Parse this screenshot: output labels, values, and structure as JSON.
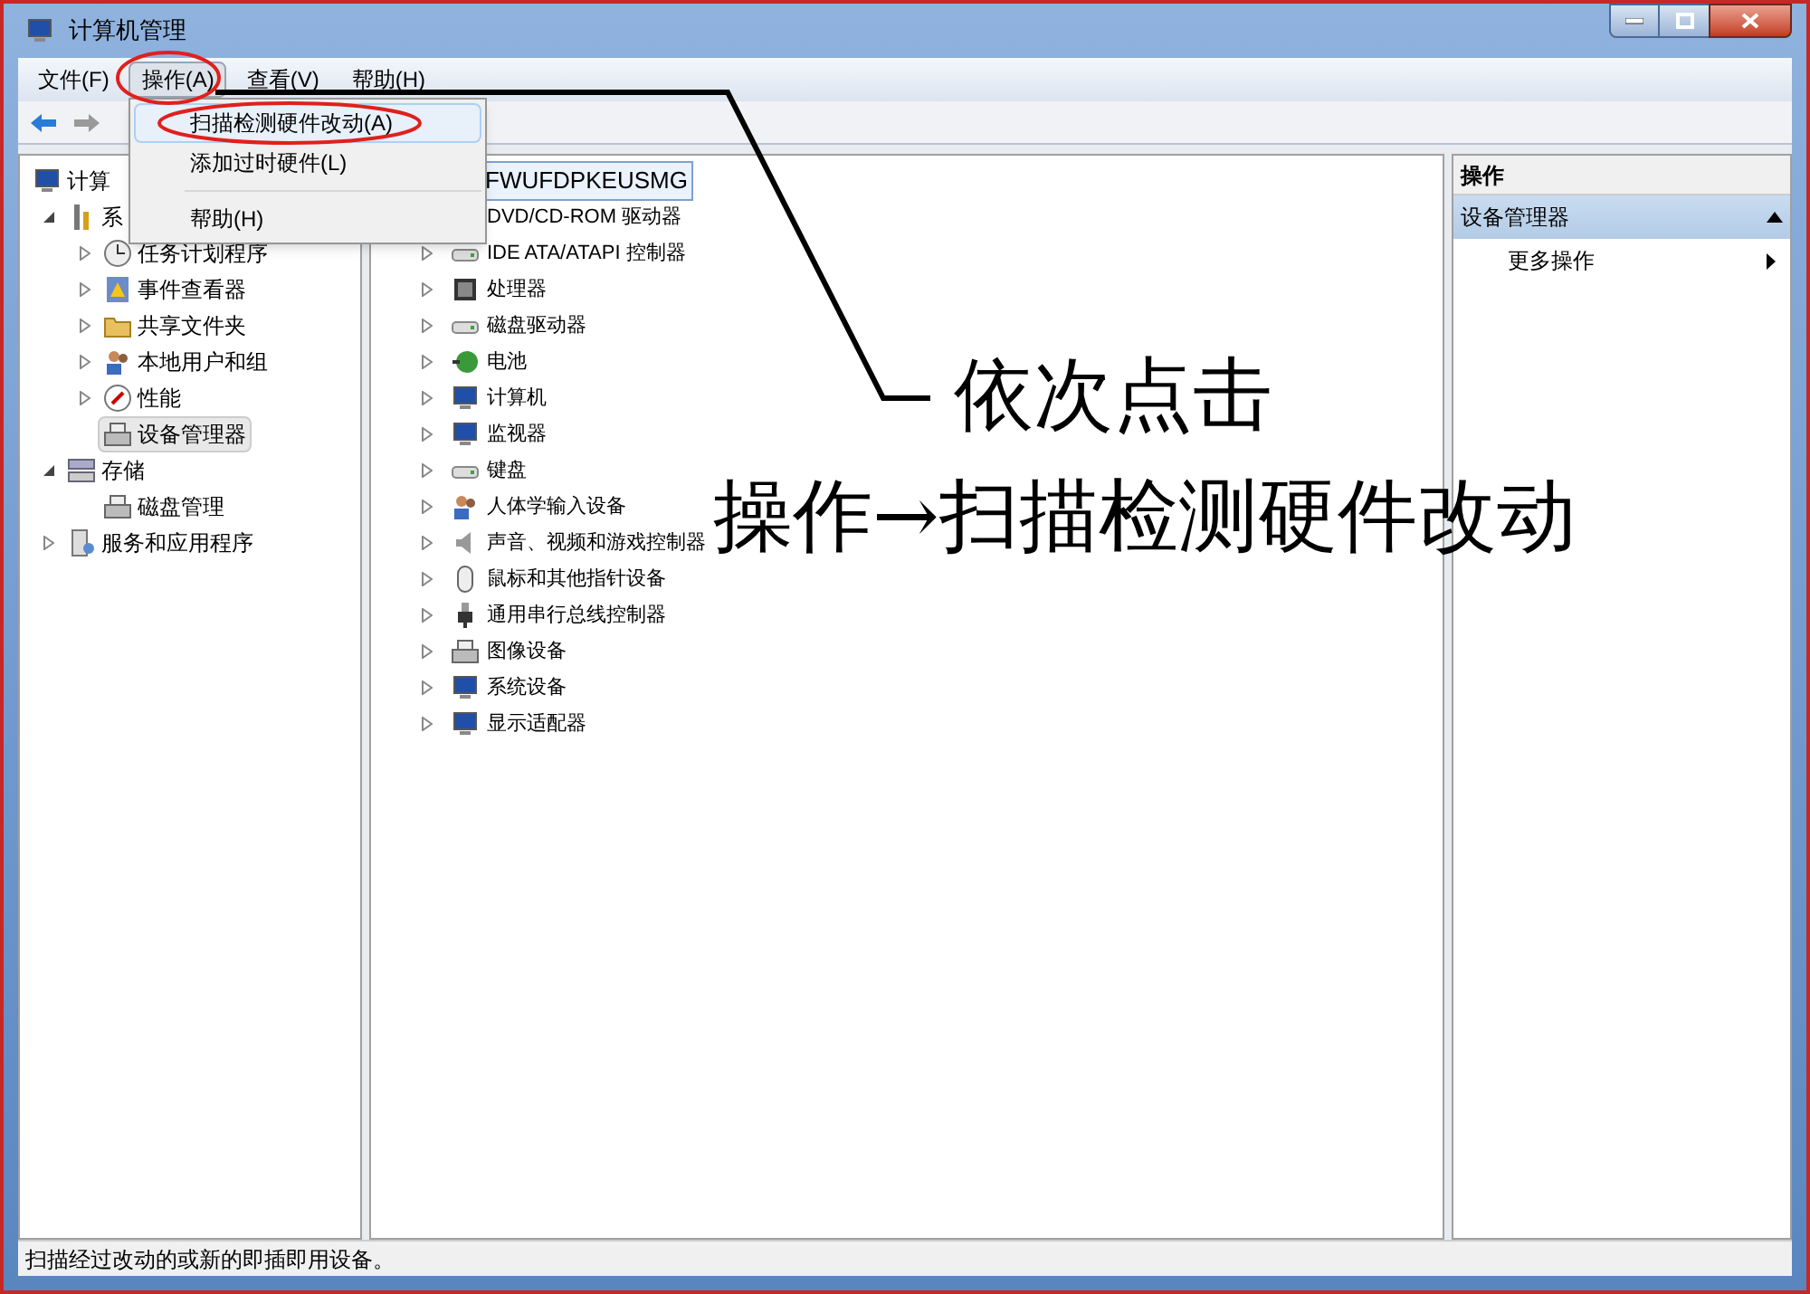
{
  "window": {
    "title": "计算机管理"
  },
  "menu_bar": [
    {
      "label": "文件(F)",
      "selected": false
    },
    {
      "label": "操作(A)",
      "selected": true
    },
    {
      "label": "查看(V)",
      "selected": false
    },
    {
      "label": "帮助(H)",
      "selected": false
    }
  ],
  "dropdown": [
    {
      "kind": "item",
      "label": "扫描检测硬件改动(A)",
      "selected": true
    },
    {
      "kind": "item",
      "label": "添加过时硬件(L)",
      "selected": false
    },
    {
      "kind": "separator"
    },
    {
      "kind": "item",
      "label": "帮助(H)",
      "selected": false
    }
  ],
  "nav_tree": [
    {
      "label": "计算",
      "kind": "computer",
      "selected": false,
      "children": [
        {
          "label": "系",
          "kind": "tools",
          "expanded": true,
          "selected": false,
          "children": [
            {
              "label": "任务计划程序",
              "kind": "clock",
              "expanded": false,
              "selected": false
            },
            {
              "label": "事件查看器",
              "kind": "event",
              "expanded": false,
              "selected": false
            },
            {
              "label": "共享文件夹",
              "kind": "folder",
              "expanded": false,
              "selected": false
            },
            {
              "label": "本地用户和组",
              "kind": "users",
              "expanded": false,
              "selected": false
            },
            {
              "label": "性能",
              "kind": "gauge",
              "expanded": false,
              "selected": false
            },
            {
              "label": "设备管理器",
              "kind": "device",
              "selected": true
            }
          ]
        },
        {
          "label": "存储",
          "kind": "storage",
          "expanded": true,
          "selected": false,
          "children": [
            {
              "label": "磁盘管理",
              "kind": "device",
              "selected": false
            }
          ]
        },
        {
          "label": "服务和应用程序",
          "kind": "services",
          "expanded": false,
          "selected": false
        }
      ]
    }
  ],
  "device_tree": {
    "label": "FWUFDPKEUSMG",
    "selected": true,
    "children": [
      {
        "label": "DVD/CD-ROM 驱动器"
      },
      {
        "label": "IDE ATA/ATAPI 控制器",
        "kind": "drive",
        "expanded": false
      },
      {
        "label": "处理器",
        "kind": "chip",
        "expanded": false
      },
      {
        "label": "磁盘驱动器",
        "kind": "drive",
        "expanded": false
      },
      {
        "label": "电池",
        "kind": "battery",
        "expanded": false
      },
      {
        "label": "计算机",
        "kind": "computer",
        "expanded": false
      },
      {
        "label": "监视器",
        "kind": "computer",
        "expanded": false
      },
      {
        "label": "键盘",
        "kind": "drive",
        "expanded": false
      },
      {
        "label": "人体学输入设备",
        "kind": "users",
        "expanded": false
      },
      {
        "label": "声音、视频和游戏控制器",
        "kind": "speaker",
        "expanded": false
      },
      {
        "label": "鼠标和其他指针设备",
        "kind": "mouse",
        "expanded": false
      },
      {
        "label": "通用串行总线控制器",
        "kind": "usb",
        "expanded": false
      },
      {
        "label": "图像设备",
        "kind": "device",
        "expanded": false
      },
      {
        "label": "系统设备",
        "kind": "computer",
        "expanded": false
      },
      {
        "label": "显示适配器",
        "kind": "computer",
        "expanded": false
      }
    ]
  },
  "actions": {
    "title": "操作",
    "section": {
      "label": "设备管理器",
      "expanded": true
    },
    "items": [
      "更多操作"
    ]
  },
  "status_bar": "扫描经过改动的或新的即插即用设备。",
  "annotation": {
    "line1": "依次点击",
    "line2": "操作→扫描检测硬件改动"
  }
}
